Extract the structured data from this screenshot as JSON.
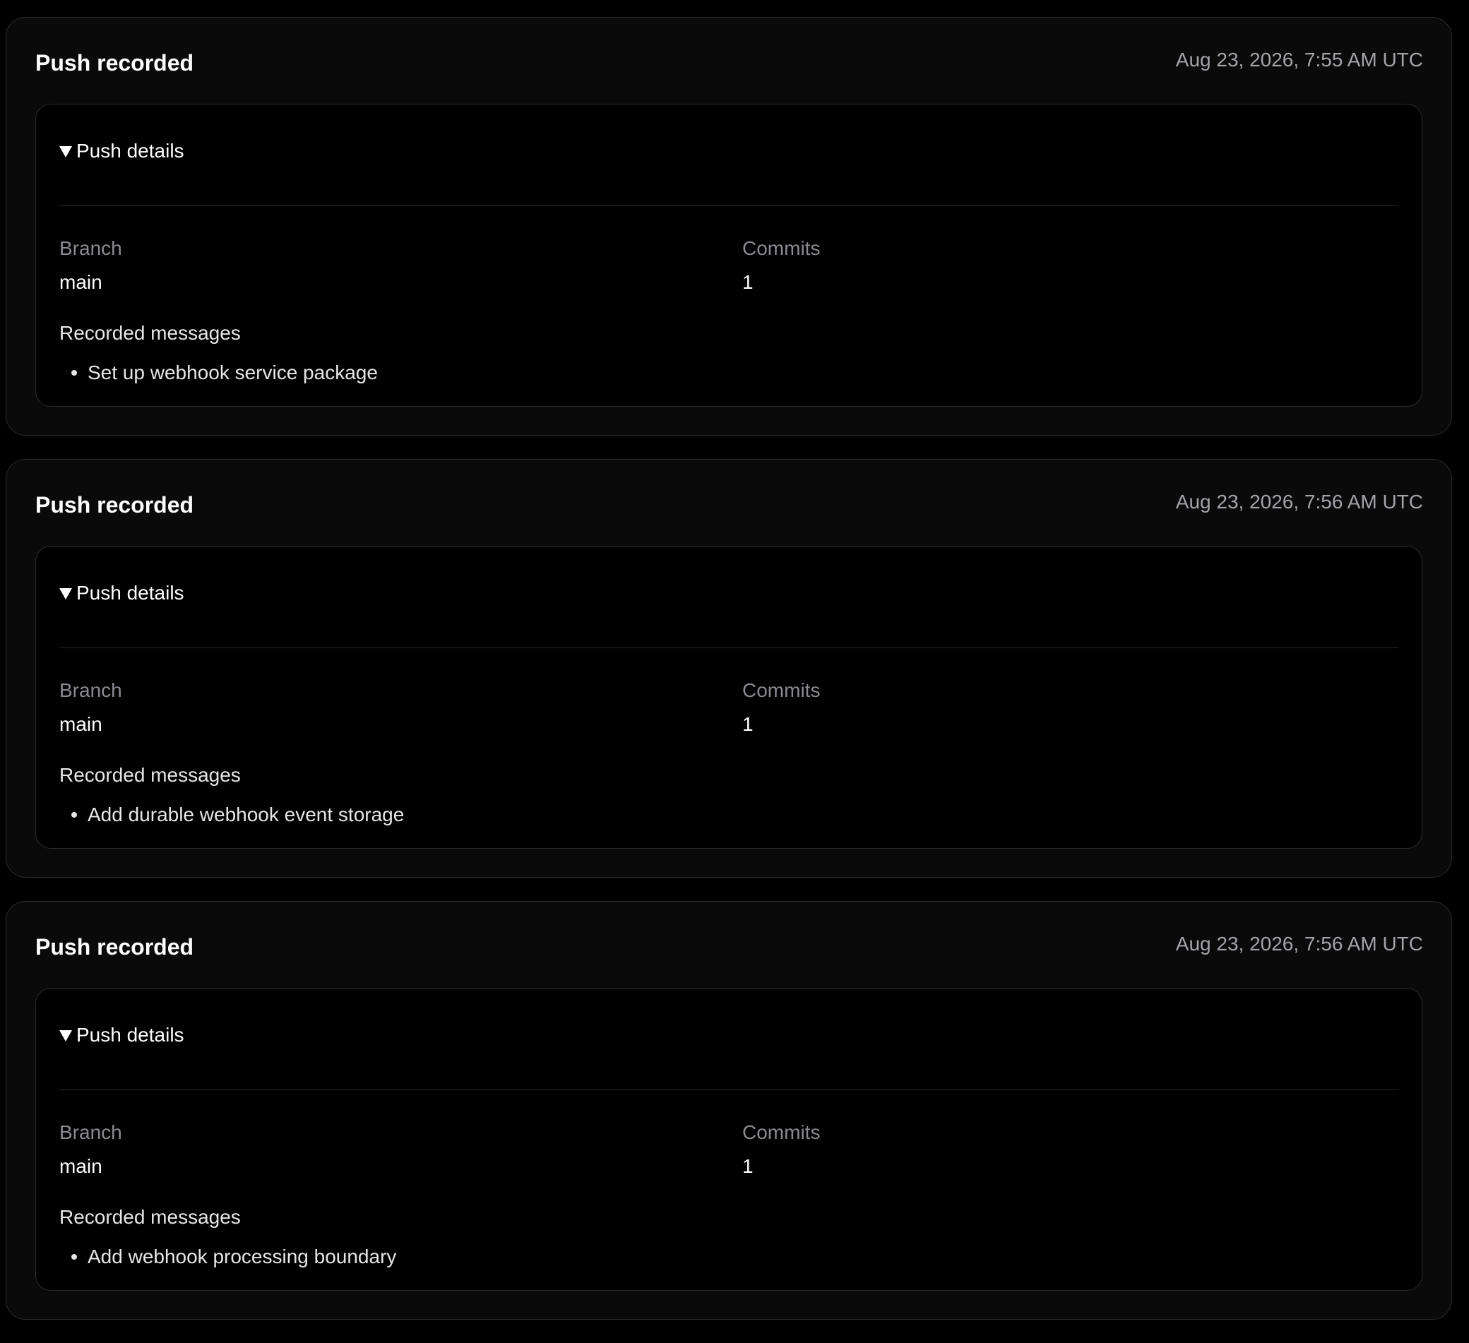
{
  "events": [
    {
      "title": "Push recorded",
      "timestamp": "Aug 23, 2026, 7:55 AM UTC",
      "details": {
        "summary": "Push details",
        "branch_label": "Branch",
        "branch": "main",
        "commits_label": "Commits",
        "commits": "1",
        "messages_label": "Recorded messages",
        "messages": [
          "Set up webhook service package"
        ]
      }
    },
    {
      "title": "Push recorded",
      "timestamp": "Aug 23, 2026, 7:56 AM UTC",
      "details": {
        "summary": "Push details",
        "branch_label": "Branch",
        "branch": "main",
        "commits_label": "Commits",
        "commits": "1",
        "messages_label": "Recorded messages",
        "messages": [
          "Add durable webhook event storage"
        ]
      }
    },
    {
      "title": "Push recorded",
      "timestamp": "Aug 23, 2026, 7:56 AM UTC",
      "details": {
        "summary": "Push details",
        "branch_label": "Branch",
        "branch": "main",
        "commits_label": "Commits",
        "commits": "1",
        "messages_label": "Recorded messages",
        "messages": [
          "Add webhook processing boundary"
        ]
      }
    }
  ]
}
